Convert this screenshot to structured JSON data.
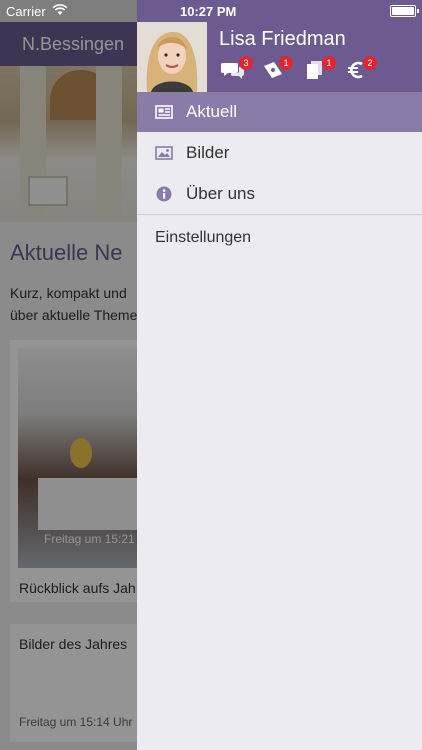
{
  "status_bar": {
    "carrier": "Carrier",
    "time": "10:27 PM",
    "battery_level": 1.0
  },
  "background": {
    "nav_title": "N.Bessingen",
    "section_heading": "Aktuelle Ne",
    "intro_line1": "Kurz, kompakt und",
    "intro_line2": "über aktuelle Theme",
    "card1": {
      "time": "Freitag um 15:21",
      "title": "Rückblick aufs Jah"
    },
    "card2": {
      "title": "Bilder des Jahres",
      "time": "Freitag um 15:14 Uhr"
    }
  },
  "drawer": {
    "user_name": "Lisa Friedman",
    "header_icons": [
      {
        "icon": "chat-bubbles-icon",
        "badge": "3"
      },
      {
        "icon": "ticket-icon",
        "badge": "1"
      },
      {
        "icon": "documents-icon",
        "badge": "1"
      },
      {
        "icon": "euro-icon",
        "badge": "2"
      }
    ],
    "menu": [
      {
        "icon": "newspaper-icon",
        "label": "Aktuell"
      },
      {
        "icon": "image-icon",
        "label": "Bilder"
      },
      {
        "icon": "info-icon",
        "label": "Über uns"
      }
    ],
    "settings_label": "Einstellungen"
  },
  "colors": {
    "brand": "#6c5a91",
    "active_item": "#8a7ba9",
    "badge": "#e1262f",
    "drawer_bg": "#ecebf1"
  }
}
